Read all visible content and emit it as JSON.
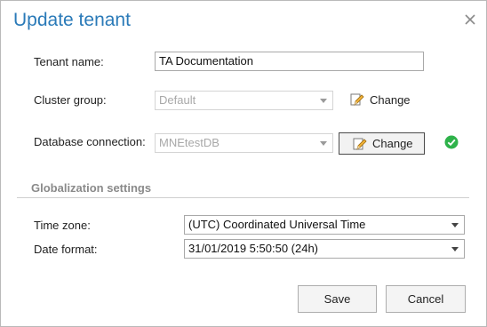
{
  "dialog": {
    "title": "Update tenant"
  },
  "form": {
    "tenant_name": {
      "label": "Tenant name:",
      "value": "TA Documentation"
    },
    "cluster_group": {
      "label": "Cluster group:",
      "value": "Default",
      "change_label": "Change"
    },
    "database_connection": {
      "label": "Database connection:",
      "value": "MNEtestDB",
      "change_label": "Change",
      "status_icon": "check-circle-icon"
    }
  },
  "globalization": {
    "section_title": "Globalization settings",
    "time_zone": {
      "label": "Time zone:",
      "value": "(UTC) Coordinated Universal Time"
    },
    "date_format": {
      "label": "Date format:",
      "value": "31/01/2019 5:50:50 (24h)"
    }
  },
  "actions": {
    "save_label": "Save",
    "cancel_label": "Cancel"
  },
  "colors": {
    "title": "#2a7ab8",
    "ok_green": "#2eb24a",
    "section_title": "#8a8a8a"
  }
}
